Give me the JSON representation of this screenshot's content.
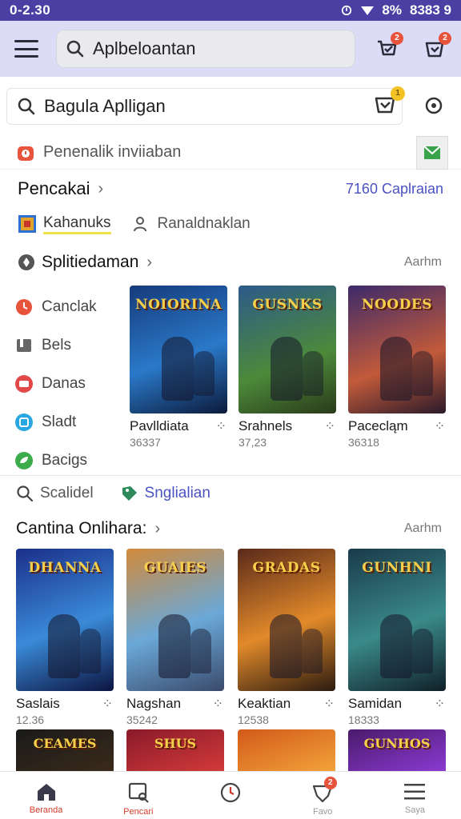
{
  "status_bar": {
    "time": "0-2.30",
    "battery": "8%",
    "signal_text": "8383 9"
  },
  "appbar": {
    "search_text": "Aplbeloantan",
    "cart_badge": "2",
    "heart_badge": "2"
  },
  "search2": {
    "text": "Bagula Aplligan",
    "cart_badge": "1"
  },
  "notice": {
    "text": "Penenalik inviiaban"
  },
  "section1": {
    "title": "Pencakai",
    "link": "7160 Caplraian"
  },
  "chips": [
    {
      "label": "Kahanuks",
      "icon": "game-tile-icon"
    },
    {
      "label": "Ranaldnaklan",
      "icon": "users-icon"
    }
  ],
  "section2": {
    "title": "Splitiedaman",
    "more": "Aarhm"
  },
  "categories": [
    {
      "label": "Canclak",
      "icon": "clock-icon",
      "color": "#e8533c"
    },
    {
      "label": "Bels",
      "icon": "bookmark-icon",
      "color": "#666666"
    },
    {
      "label": "Danas",
      "icon": "card-icon",
      "color": "#e24a4a"
    },
    {
      "label": "Sladt",
      "icon": "square-icon",
      "color": "#28a8e0"
    },
    {
      "label": "Bacigs",
      "icon": "leaf-icon",
      "color": "#3cab4a"
    }
  ],
  "games_row1": [
    {
      "name": "Pavlldiata",
      "count": "36337",
      "logo": "NOIORINA",
      "bg1": "#163a7a",
      "bg2": "#2a79c9"
    },
    {
      "name": "Srahnels",
      "count": "37,23",
      "logo": "GUSNKS",
      "bg1": "#2c5a8a",
      "bg2": "#4c8a3a"
    },
    {
      "name": "Pacecląm",
      "count": "36318",
      "logo": "NOODES",
      "bg1": "#3c2a6a",
      "bg2": "#c25a3a"
    }
  ],
  "tabs2": [
    {
      "label": "Scalidel",
      "icon": "search-icon"
    },
    {
      "label": "Snglialian",
      "icon": "tag-icon"
    }
  ],
  "section3": {
    "title": "Cantina Onlihara:",
    "more": "Aarhm"
  },
  "games_row2": [
    {
      "name": "Saslais",
      "count": "12.36",
      "logo": "DHANNA",
      "bg1": "#1b2f8a",
      "bg2": "#3a8ad8"
    },
    {
      "name": "Nagshan",
      "count": "35242",
      "logo": "GUAIES",
      "bg1": "#d28a3a",
      "bg2": "#6aa8d8"
    },
    {
      "name": "Keaktian",
      "count": "12538",
      "logo": "GRADAS",
      "bg1": "#5a2a1a",
      "bg2": "#e28a2a"
    },
    {
      "name": "Samidan",
      "count": "18333",
      "logo": "GUNHNI",
      "bg1": "#1a3a4a",
      "bg2": "#3a8a8a"
    }
  ],
  "games_row3": [
    {
      "logo": "CEAMES",
      "bg1": "#1a1a1a",
      "bg2": "#3a2a1a"
    },
    {
      "logo": "SHUS",
      "bg1": "#8a1a2a",
      "bg2": "#d23a3a"
    },
    {
      "logo": "",
      "bg1": "#d25a1a",
      "bg2": "#f2a23a"
    },
    {
      "logo": "GUNHOS",
      "bg1": "#4a1a6a",
      "bg2": "#8a3ad2"
    }
  ],
  "bottom_nav": [
    {
      "label": "Beranda",
      "icon": "home-icon",
      "active": true
    },
    {
      "label": "Pencari",
      "icon": "search-tab-icon",
      "active": true
    },
    {
      "label": "",
      "icon": "clock-icon"
    },
    {
      "label": "Favo",
      "icon": "heart-icon",
      "badge": "2"
    },
    {
      "label": "Saya",
      "icon": "menu-icon"
    }
  ]
}
